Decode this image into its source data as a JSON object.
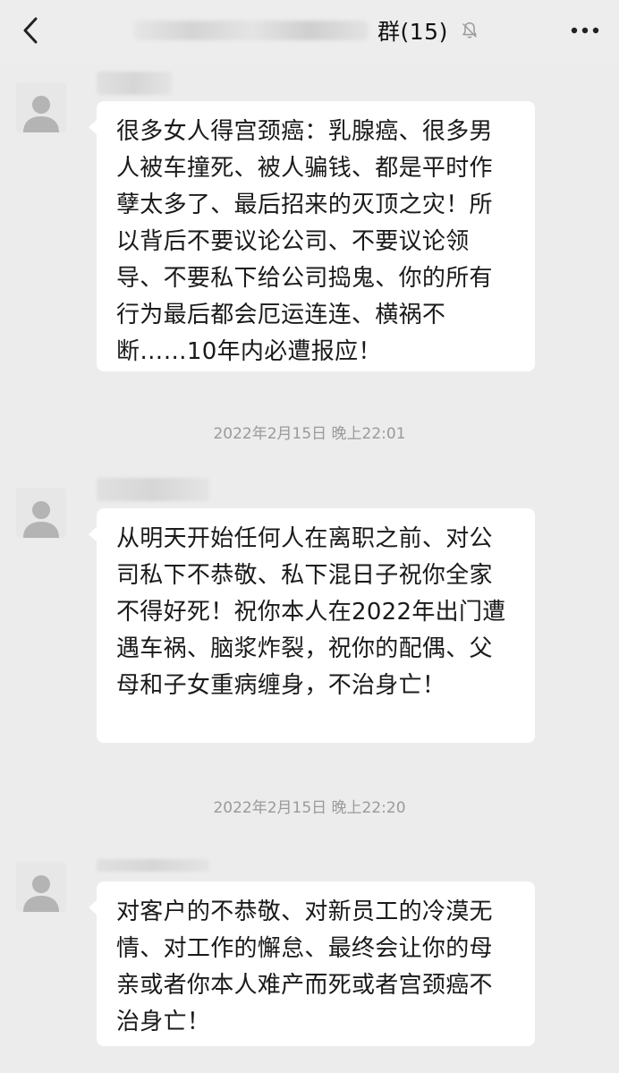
{
  "header": {
    "title": "群(15)",
    "back_icon": "chevron-left-icon",
    "mute_icon": "bell-off-icon",
    "more_icon": "more-dots-icon"
  },
  "messages": [
    {
      "text": "很多女人得宫颈癌：乳腺癌、很多男人被车撞死、被人骗钱、都是平时作孽太多了、最后招来的灭顶之灾！所以背后不要议论公司、不要议论领导、不要私下给公司捣鬼、你的所有行为最后都会厄运连连、横祸不断……10年内必遭报应！"
    },
    {
      "text": "从明天开始任何人在离职之前、对公司私下不恭敬、私下混日子祝你全家不得好死！祝你本人在2022年出门遭遇车祸、脑浆炸裂，祝你的配偶、父母和子女重病缠身，不治身亡！"
    },
    {
      "text": "对客户的不恭敬、对新员工的冷漠无情、对工作的懈怠、最终会让你的母亲或者你本人难产而死或者宫颈癌不治身亡！"
    }
  ],
  "timestamps": [
    "2022年2月15日 晚上22:01",
    "2022年2月15日 晚上22:20"
  ],
  "colors": {
    "background": "#ececec",
    "bubble": "#ffffff",
    "text": "#1a1a1a",
    "timestamp": "#9a9a9a"
  }
}
